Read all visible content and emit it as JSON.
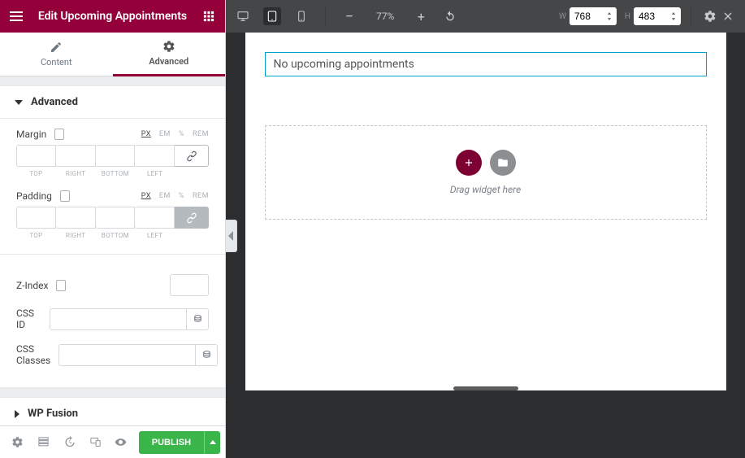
{
  "panel": {
    "title": "Edit Upcoming Appointments",
    "tabs": {
      "content": "Content",
      "advanced": "Advanced",
      "active": "advanced"
    },
    "sections": {
      "advanced": "Advanced",
      "wpfusion": "WP Fusion"
    },
    "controls": {
      "margin_label": "Margin",
      "padding_label": "Padding",
      "units": [
        "PX",
        "EM",
        "%",
        "REM"
      ],
      "unit_active": "PX",
      "sublabels": [
        "TOP",
        "RIGHT",
        "BOTTOM",
        "LEFT"
      ],
      "zindex": "Z-Index",
      "cssid": "CSS ID",
      "cssclasses": "CSS Classes"
    },
    "footer": {
      "publish": "PUBLISH"
    }
  },
  "topbar": {
    "zoom": "77%",
    "w_label": "W",
    "h_label": "H",
    "width": "768",
    "height": "483"
  },
  "canvas": {
    "no_upcoming": "No upcoming appointments",
    "drag_here": "Drag widget here"
  }
}
